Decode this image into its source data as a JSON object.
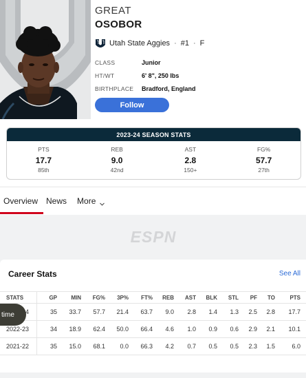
{
  "player": {
    "first_name": "GREAT",
    "last_name": "OSOBOR",
    "team": "Utah State Aggies",
    "number": "#1",
    "position": "F",
    "team_logo_icon": "utah-state-logo-icon"
  },
  "bio": [
    {
      "key": "CLASS",
      "value": "Junior"
    },
    {
      "key": "HT/WT",
      "value": "6' 8\", 250 lbs"
    },
    {
      "key": "BIRTHPLACE",
      "value": "Bradford, England"
    }
  ],
  "follow_label": "Follow",
  "season": {
    "title": "2023-24 SEASON STATS",
    "stats": [
      {
        "label": "PTS",
        "value": "17.7",
        "rank": "85th"
      },
      {
        "label": "REB",
        "value": "9.0",
        "rank": "42nd"
      },
      {
        "label": "AST",
        "value": "2.8",
        "rank": "150+"
      },
      {
        "label": "FG%",
        "value": "57.7",
        "rank": "27th"
      }
    ]
  },
  "tabs": [
    {
      "label": "Overview",
      "active": true
    },
    {
      "label": "News",
      "active": false
    },
    {
      "label": "More",
      "active": false
    }
  ],
  "brand": {
    "logo_text": "ESPN"
  },
  "career": {
    "title": "Career Stats",
    "see_all": "See All",
    "headers": [
      "STATS",
      "GP",
      "MIN",
      "FG%",
      "3P%",
      "FT%",
      "REB",
      "AST",
      "BLK",
      "STL",
      "PF",
      "TO",
      "PTS"
    ],
    "rows": [
      [
        "2023-24",
        "35",
        "33.7",
        "57.7",
        "21.4",
        "63.7",
        "9.0",
        "2.8",
        "1.4",
        "1.3",
        "2.5",
        "2.8",
        "17.7"
      ],
      [
        "2022-23",
        "34",
        "18.9",
        "62.4",
        "50.0",
        "66.4",
        "4.6",
        "1.0",
        "0.9",
        "0.6",
        "2.9",
        "2.1",
        "10.1"
      ],
      [
        "2021-22",
        "35",
        "15.0",
        "68.1",
        "0.0",
        "66.3",
        "4.2",
        "0.7",
        "0.5",
        "0.5",
        "2.3",
        "1.5",
        "6.0"
      ]
    ]
  },
  "overlay": {
    "pill_text": "time"
  },
  "colors": {
    "accent_blue": "#3a71d9",
    "season_header": "#0b2a3a",
    "active_tab": "#d0021b",
    "link": "#2a6ad6",
    "gray_bg": "#f1f2f3"
  }
}
